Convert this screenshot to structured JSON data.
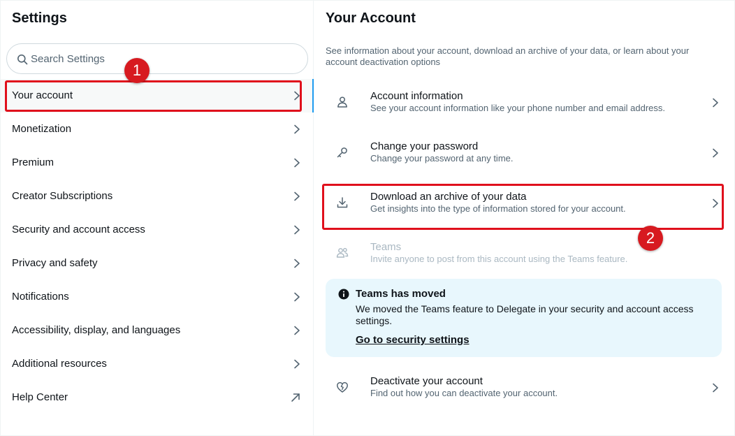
{
  "sidebar": {
    "title": "Settings",
    "search_placeholder": "Search Settings",
    "items": [
      {
        "label": "Your account"
      },
      {
        "label": "Monetization"
      },
      {
        "label": "Premium"
      },
      {
        "label": "Creator Subscriptions"
      },
      {
        "label": "Security and account access"
      },
      {
        "label": "Privacy and safety"
      },
      {
        "label": "Notifications"
      },
      {
        "label": "Accessibility, display, and languages"
      },
      {
        "label": "Additional resources"
      },
      {
        "label": "Help Center"
      }
    ]
  },
  "main": {
    "title": "Your Account",
    "description": "See information about your account, download an archive of your data, or learn about your account deactivation options",
    "options": [
      {
        "title": "Account information",
        "subtitle": "See your account information like your phone number and email address."
      },
      {
        "title": "Change your password",
        "subtitle": "Change your password at any time."
      },
      {
        "title": "Download an archive of your data",
        "subtitle": "Get insights into the type of information stored for your account."
      },
      {
        "title": "Teams",
        "subtitle": "Invite anyone to post from this account using the Teams feature."
      },
      {
        "title": "Deactivate your account",
        "subtitle": "Find out how you can deactivate your account."
      }
    ],
    "notice": {
      "title": "Teams has moved",
      "body": "We moved the Teams feature to Delegate in your security and account access settings.",
      "link": "Go to security settings"
    }
  },
  "annotations": {
    "badge_1": "1",
    "badge_2": "2"
  },
  "colors": {
    "accent": "#1d9bf0",
    "highlight": "#e0101c",
    "notice_bg": "#e8f7fd"
  }
}
